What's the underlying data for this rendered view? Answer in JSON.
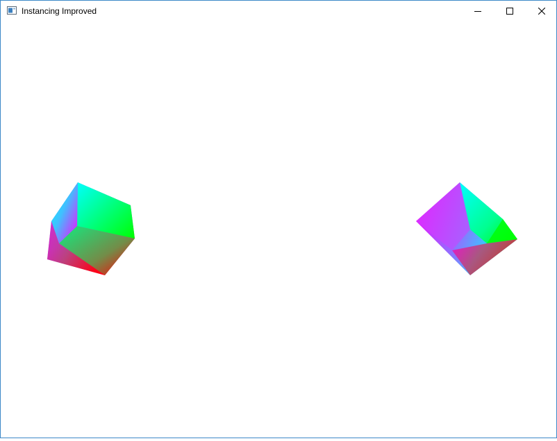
{
  "window": {
    "title": "Instancing Improved"
  },
  "titlebar": {
    "icons": [
      "app-icon",
      "minimize-icon",
      "maximize-icon",
      "close-icon"
    ]
  },
  "viewport": {
    "background": "#ffffff",
    "objects": [
      {
        "type": "cube",
        "colors": [
          "#00ffff",
          "#00ff00",
          "#ff00ff",
          "#ff0000"
        ]
      },
      {
        "type": "cube",
        "colors": [
          "#00ffff",
          "#00ff00",
          "#ff00ff",
          "#ff0000"
        ]
      }
    ]
  }
}
